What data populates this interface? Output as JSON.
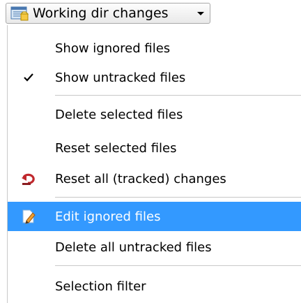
{
  "button": {
    "label": "Working dir changes",
    "icon": "folder-changes-icon",
    "dropdown_icon": "chevron-down-icon"
  },
  "menu": {
    "items": [
      {
        "label": "Show ignored files",
        "checked": false,
        "icon": ""
      },
      {
        "label": "Show untracked files",
        "checked": true,
        "icon": "checkmark-icon"
      },
      {
        "label": "Delete selected files",
        "checked": false,
        "icon": ""
      },
      {
        "label": "Reset selected files",
        "checked": false,
        "icon": ""
      },
      {
        "label": "Reset all (tracked) changes",
        "checked": false,
        "icon": "undo-red-icon"
      },
      {
        "label": "Edit ignored files",
        "checked": false,
        "icon": "edit-pencil-icon",
        "selected": true
      },
      {
        "label": "Delete all untracked files",
        "checked": false,
        "icon": ""
      },
      {
        "label": "Selection filter",
        "checked": false,
        "icon": ""
      }
    ]
  },
  "colors": {
    "highlight": "#3399ff",
    "highlight_text": "#ffffff",
    "separator": "#c8c8c8"
  }
}
